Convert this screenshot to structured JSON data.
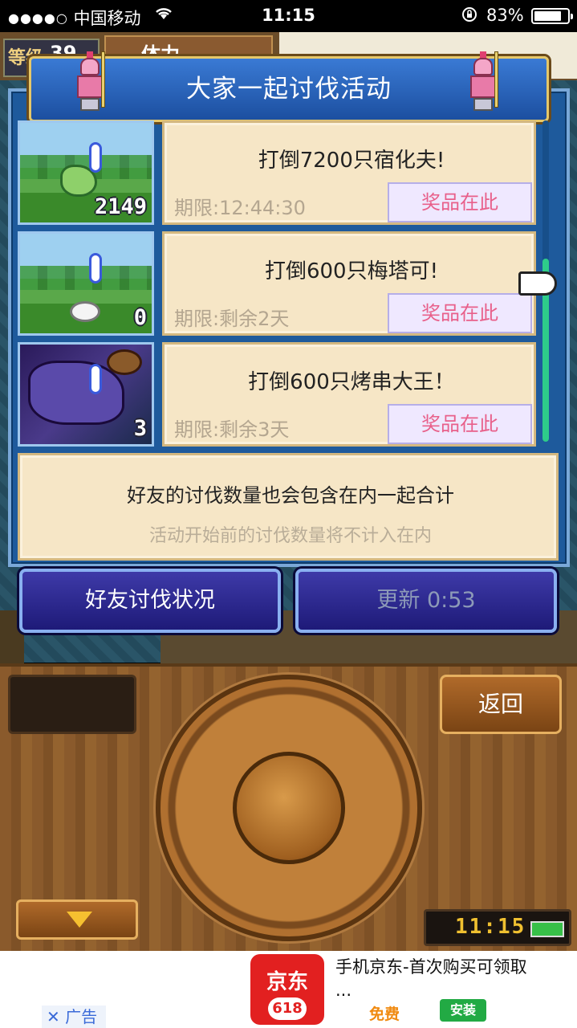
{
  "status_bar": {
    "carrier_dots": "●●●●○",
    "carrier": "中国移动",
    "time": "11:15",
    "battery_percent": "83%",
    "battery_level": 0.83
  },
  "hud": {
    "level_label": "等级",
    "level_value": "39",
    "stamina_label": "体力"
  },
  "event": {
    "title": "大家一起讨伐活动",
    "tasks": [
      {
        "task": "打倒7200只宿化夫!",
        "deadline": "期限:12:44:30",
        "reward_label": "奖品在此",
        "count": "2149",
        "monster": "plant-monster"
      },
      {
        "task": "打倒600只梅塔可!",
        "deadline": "期限:剩余2天",
        "reward_label": "奖品在此",
        "count": "0",
        "monster": "bunny-monster"
      },
      {
        "task": "打倒600只烤串大王！",
        "deadline": "期限:剩余3天",
        "reward_label": "奖品在此",
        "count": "3",
        "monster": "dragon-monster"
      }
    ],
    "notice_line1": "好友的讨伐数量也会包含在内一起合计",
    "notice_line2": "活动开始前的讨伐数量将不计入在内",
    "friend_status_button": "好友讨伐状况",
    "refresh_button": "更新 0:53"
  },
  "controller": {
    "back_button": "返回",
    "clock": "11:15"
  },
  "ad": {
    "close_label": "广告",
    "logo_name": "京东",
    "logo_sub": "618",
    "title": "手机京东-首次购买可领取 ...",
    "price": "免费",
    "install_button": "安装"
  },
  "colors": {
    "dialog_blue": "#1e5a9c",
    "card_cream": "#f6e6c6",
    "reward_pink": "#e8608a",
    "button_navy": "#2a2690",
    "wood": "#8a5a2c"
  }
}
